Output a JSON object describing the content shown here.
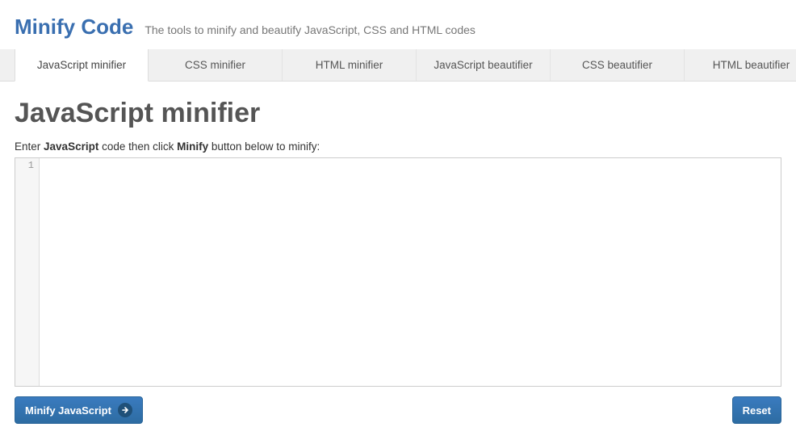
{
  "header": {
    "logo": "Minify Code",
    "tagline": "The tools to minify and beautify JavaScript, CSS and HTML codes"
  },
  "tabs": [
    {
      "label": "JavaScript minifier",
      "active": true
    },
    {
      "label": "CSS minifier",
      "active": false
    },
    {
      "label": "HTML minifier",
      "active": false
    },
    {
      "label": "JavaScript beautifier",
      "active": false
    },
    {
      "label": "CSS beautifier",
      "active": false
    },
    {
      "label": "HTML beautifier",
      "active": false
    }
  ],
  "page": {
    "title": "JavaScript minifier",
    "instruction_prefix": "Enter ",
    "instruction_strong1": "JavaScript",
    "instruction_mid": " code then click ",
    "instruction_strong2": "Minify",
    "instruction_suffix": " button below to minify:"
  },
  "editor": {
    "line_number": "1",
    "value": ""
  },
  "buttons": {
    "minify": "Minify JavaScript",
    "reset": "Reset"
  }
}
